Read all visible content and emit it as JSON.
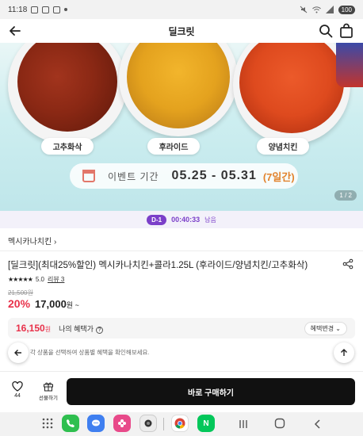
{
  "status_bar": {
    "time": "11:18",
    "battery": "100"
  },
  "header": {
    "title": "딜크릿"
  },
  "banner": {
    "items": [
      {
        "label": "고추화삭"
      },
      {
        "label": "후라이드"
      },
      {
        "label": "양념치킨"
      }
    ],
    "event_label": "이벤트 기간",
    "event_dates": "05.25 - 05.31",
    "event_duration": "(7일간)",
    "pager": "1 / 2"
  },
  "deadline": {
    "badge": "D-1",
    "timer": "00:40:33",
    "suffix": "남음"
  },
  "breadcrumb": "멕시카나치킨 ›",
  "product": {
    "title": "[딜크릿](최대25%할인) 멕시카나치킨+콜라1.25L (후라이드/양념치킨/고추화삭)",
    "stars": "★★★★★",
    "rating": "5.0",
    "reviews": "리뷰 3",
    "original_price": "21,500원",
    "discount": "20%",
    "price": "17,000",
    "price_unit": "원 ~"
  },
  "benefit": {
    "price": "16,150",
    "unit": "원",
    "label": "나의 혜택가",
    "change_button": "혜택변경 ⌄",
    "note": "각 상품을 선택하여 상품별 혜택을 확인해보세요."
  },
  "buy_bar": {
    "like_count": "44",
    "gift_label": "선물하기",
    "buy_label": "바로 구매하기"
  },
  "colors": {
    "accent_red": "#e8314a",
    "deadline_purple": "#7b3fc9",
    "buy_button": "#111111"
  },
  "nav_apps": [
    {
      "name": "apps-grid-icon"
    },
    {
      "name": "phone-app-icon"
    },
    {
      "name": "messages-app-icon"
    },
    {
      "name": "gallery-app-icon"
    },
    {
      "name": "camera-app-icon"
    },
    {
      "name": "chrome-app-icon"
    },
    {
      "name": "naver-app-icon",
      "label": "N"
    }
  ]
}
